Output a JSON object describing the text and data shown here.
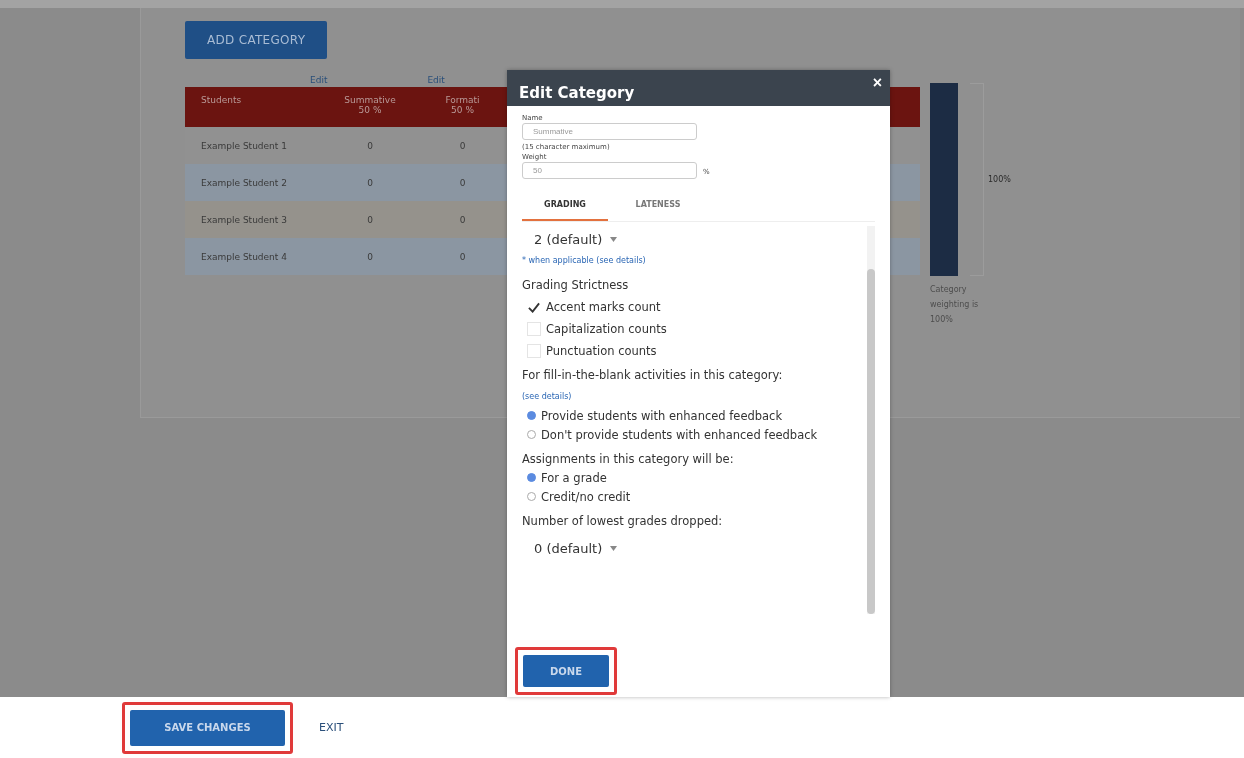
{
  "add_category_button": "ADD CATEGORY",
  "table": {
    "edit_links": [
      "Edit",
      "Edit"
    ],
    "columns": [
      {
        "label": "Students"
      },
      {
        "label": "Summative",
        "sub": "50 %"
      },
      {
        "label": "Formati",
        "sub": "50 %"
      }
    ],
    "rows": [
      {
        "cells": [
          "Example Student 1",
          "0",
          "0"
        ]
      },
      {
        "cells": [
          "Example Student 2",
          "0",
          "0"
        ]
      },
      {
        "cells": [
          "Example Student 3",
          "0",
          "0"
        ]
      },
      {
        "cells": [
          "Example Student 4",
          "0",
          "0"
        ]
      }
    ]
  },
  "weighting": {
    "bar_label": "100%",
    "caption": "Category weighting is 100%"
  },
  "modal": {
    "title": "Edit Category",
    "close": "×",
    "name_label": "Name",
    "name_value": "Summative",
    "name_hint": "(15 character maximum)",
    "weight_label": "Weight",
    "weight_value": "50",
    "weight_unit": "%",
    "tabs": [
      {
        "label": "GRADING",
        "selected": true
      },
      {
        "label": "LATENESS",
        "selected": false
      }
    ],
    "attempts_select": "2 (default)",
    "applicable_link": "* when applicable (see details)",
    "strictness_label": "Grading Strictness",
    "strictness": [
      {
        "label": "Accent marks count",
        "checked": true
      },
      {
        "label": "Capitalization counts",
        "checked": false
      },
      {
        "label": "Punctuation counts",
        "checked": false
      }
    ],
    "fill_blank_label": "For fill-in-the-blank activities in this category:",
    "fill_blank_link": "(see details)",
    "feedback_options": [
      {
        "label": "Provide students with enhanced feedback",
        "selected": true
      },
      {
        "label": "Don't provide students with enhanced feedback",
        "selected": false
      }
    ],
    "assignments_label": "Assignments in this category will be:",
    "assignment_options": [
      {
        "label": "For a grade",
        "selected": true
      },
      {
        "label": "Credit/no credit",
        "selected": false
      }
    ],
    "dropped_label": "Number of lowest grades dropped:",
    "dropped_select": "0 (default)",
    "done_button": {
      "label": "DONE",
      "highlighted": true
    }
  },
  "footer": {
    "save_button": {
      "label": "SAVE CHANGES",
      "highlighted": true
    },
    "exit_link": "EXIT"
  }
}
